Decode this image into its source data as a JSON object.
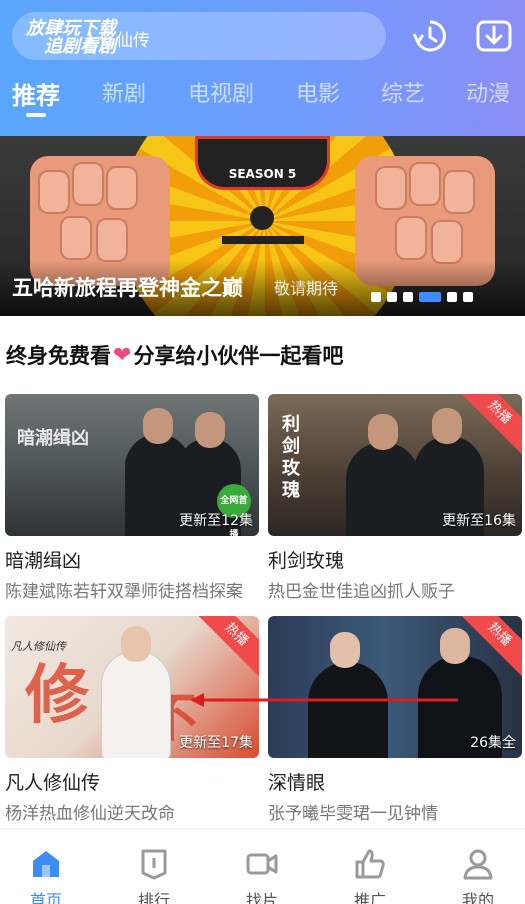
{
  "header": {
    "search_overlay_line1": "放肆玩下载",
    "search_overlay_line2": "追剧看剧",
    "search_text": "人修仙传",
    "tabs": [
      "推荐",
      "新剧",
      "电视剧",
      "电影",
      "综艺",
      "动漫"
    ],
    "active_tab": "推荐"
  },
  "banner": {
    "title": "五哈新旅程再登神金之巅",
    "subtitle": "敬请期待",
    "logo_text": "SEASON 5",
    "slides": 6,
    "active_slide": 4
  },
  "section": {
    "title_part1": "终身免费看",
    "title_part2": "分享给小伙伴一起看吧"
  },
  "cards": [
    {
      "title": "暗潮缉凶",
      "desc": "陈建斌陈若轩双犟师徒搭档探案",
      "update": "更新至12集",
      "poster_text": "暗潮缉凶",
      "badge": "全网首播"
    },
    {
      "title": "利剑玫瑰",
      "desc": "热巴金世佳追凶抓人贩子",
      "update": "更新至16集",
      "poster_text": "利剑玫瑰",
      "hot": "热播"
    },
    {
      "title": "凡人修仙传",
      "desc": "杨洋热血修仙逆天改命",
      "update": "更新至17集",
      "poster_text": "凡人修仙传",
      "hot": "热播"
    },
    {
      "title": "深情眼",
      "desc": "张予曦毕雯珺一见钟情",
      "update": "26集全",
      "hot": "热播"
    }
  ],
  "nav": {
    "items": [
      "首页",
      "排行",
      "找片",
      "推广",
      "我的"
    ],
    "active": "首页",
    "active_color": "#3b8cf5"
  },
  "colors": {
    "header_start": "#5aa6ff",
    "header_end": "#8b8ef5",
    "hot_badge": "#f04a4a",
    "accent": "#3f8cff"
  }
}
